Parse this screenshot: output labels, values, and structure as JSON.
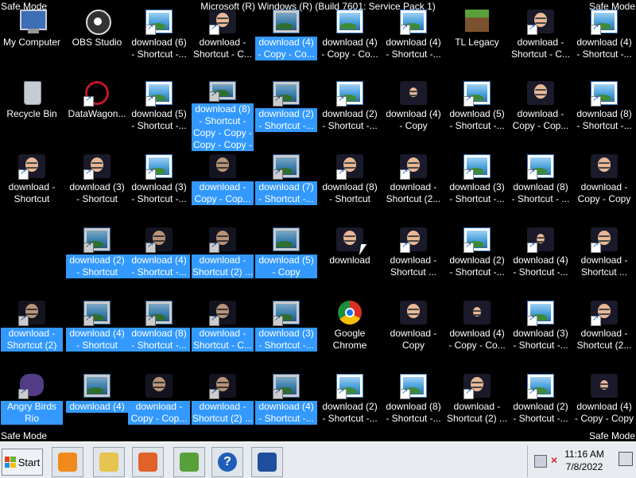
{
  "window": {
    "title": "Microsoft (R) Windows (R) (Build 7601: Service Pack 1)",
    "safe_mode": "Safe Mode"
  },
  "desktop": {
    "icons": [
      {
        "col": 0,
        "row": 0,
        "label": "My Computer",
        "img": "pc",
        "selected": false,
        "shortcut": false
      },
      {
        "col": 1,
        "row": 0,
        "label": "OBS Studio",
        "img": "obs",
        "selected": false,
        "shortcut": false
      },
      {
        "col": 2,
        "row": 0,
        "label": "download (6)\n- Shortcut -...",
        "img": "land",
        "selected": false,
        "shortcut": true
      },
      {
        "col": 3,
        "row": 0,
        "label": "download -\nShortcut - C...",
        "img": "face",
        "selected": false,
        "shortcut": true
      },
      {
        "col": 4,
        "row": 0,
        "label": "download (4)\n- Copy - Co...",
        "img": "land",
        "selected": true,
        "shortcut": false
      },
      {
        "col": 5,
        "row": 0,
        "label": "download (4)\n- Copy - Co...",
        "img": "land",
        "selected": false,
        "shortcut": false
      },
      {
        "col": 6,
        "row": 0,
        "label": "download (4)\n- Shortcut -...",
        "img": "land",
        "selected": false,
        "shortcut": true
      },
      {
        "col": 7,
        "row": 0,
        "label": "TL Legacy",
        "img": "grass",
        "selected": false,
        "shortcut": false
      },
      {
        "col": 8,
        "row": 0,
        "label": "download -\nShortcut - C...",
        "img": "face",
        "selected": false,
        "shortcut": true
      },
      {
        "col": 9,
        "row": 0,
        "label": "download (4)\n- Shortcut -...",
        "img": "land",
        "selected": false,
        "shortcut": true
      },
      {
        "col": 0,
        "row": 1,
        "label": "Recycle Bin",
        "img": "bin",
        "selected": false,
        "shortcut": false
      },
      {
        "col": 1,
        "row": 1,
        "label": "DataWagon...",
        "img": "web",
        "selected": false,
        "shortcut": true
      },
      {
        "col": 2,
        "row": 1,
        "label": "download (5)\n- Shortcut -...",
        "img": "land",
        "selected": false,
        "shortcut": true
      },
      {
        "col": 3,
        "row": 1,
        "label": "download (8)\n- Shortcut -\nCopy - Copy -\nCopy - Copy -\nCopy",
        "img": "land",
        "selected": true,
        "shortcut": true
      },
      {
        "col": 4,
        "row": 1,
        "label": "download (2)\n- Shortcut -...",
        "img": "land",
        "selected": true,
        "shortcut": true
      },
      {
        "col": 5,
        "row": 1,
        "label": "download (2)\n- Shortcut -...",
        "img": "land",
        "selected": false,
        "shortcut": true
      },
      {
        "col": 6,
        "row": 1,
        "label": "download (4)\n- Copy",
        "img": "facesmall",
        "selected": false,
        "shortcut": false
      },
      {
        "col": 7,
        "row": 1,
        "label": "download (5)\n- Shortcut -...",
        "img": "land",
        "selected": false,
        "shortcut": true
      },
      {
        "col": 8,
        "row": 1,
        "label": "download -\nCopy - Cop...",
        "img": "face",
        "selected": false,
        "shortcut": false
      },
      {
        "col": 9,
        "row": 1,
        "label": "download (8)\n- Shortcut -...",
        "img": "land",
        "selected": false,
        "shortcut": true
      },
      {
        "col": 0,
        "row": 2,
        "label": "download -\nShortcut",
        "img": "face",
        "selected": false,
        "shortcut": true
      },
      {
        "col": 1,
        "row": 2,
        "label": "download (3)\n- Shortcut",
        "img": "face",
        "selected": false,
        "shortcut": true
      },
      {
        "col": 2,
        "row": 2,
        "label": "download (3)\n- Shortcut -...",
        "img": "land",
        "selected": false,
        "shortcut": true
      },
      {
        "col": 3,
        "row": 2,
        "label": "download -\nCopy - Cop...",
        "img": "face",
        "selected": true,
        "shortcut": false
      },
      {
        "col": 4,
        "row": 2,
        "label": "download (7)\n- Shortcut -...",
        "img": "land",
        "selected": true,
        "shortcut": true
      },
      {
        "col": 5,
        "row": 2,
        "label": "download (8)\n- Shortcut",
        "img": "face",
        "selected": false,
        "shortcut": true
      },
      {
        "col": 6,
        "row": 2,
        "label": "download -\nShortcut (2...",
        "img": "face",
        "selected": false,
        "shortcut": true
      },
      {
        "col": 7,
        "row": 2,
        "label": "download (3)\n- Shortcut -...",
        "img": "land",
        "selected": false,
        "shortcut": true
      },
      {
        "col": 8,
        "row": 2,
        "label": "download (8)\n- Shortcut - ...",
        "img": "land",
        "selected": false,
        "shortcut": true
      },
      {
        "col": 9,
        "row": 2,
        "label": "download -\nCopy - Copy",
        "img": "face",
        "selected": false,
        "shortcut": false
      },
      {
        "col": 1,
        "row": 3,
        "label": "download (2)\n- Shortcut",
        "img": "land",
        "selected": true,
        "shortcut": true
      },
      {
        "col": 2,
        "row": 3,
        "label": "download (4)\n- Shortcut -...",
        "img": "face",
        "selected": true,
        "shortcut": true
      },
      {
        "col": 3,
        "row": 3,
        "label": "download -\nShortcut (2) ...",
        "img": "face",
        "selected": true,
        "shortcut": true
      },
      {
        "col": 4,
        "row": 3,
        "label": "download (5)\n- Copy",
        "img": "land",
        "selected": true,
        "shortcut": false
      },
      {
        "col": 5,
        "row": 3,
        "label": "download",
        "img": "face",
        "selected": false,
        "shortcut": false
      },
      {
        "col": 6,
        "row": 3,
        "label": "download -\nShortcut ...",
        "img": "face",
        "selected": false,
        "shortcut": true
      },
      {
        "col": 7,
        "row": 3,
        "label": "download (2)\n- Shortcut -...",
        "img": "land",
        "selected": false,
        "shortcut": true
      },
      {
        "col": 8,
        "row": 3,
        "label": "download (4)\n- Shortcut -...",
        "img": "facesmall",
        "selected": false,
        "shortcut": true
      },
      {
        "col": 9,
        "row": 3,
        "label": "download -\nShortcut ...",
        "img": "face",
        "selected": false,
        "shortcut": true
      },
      {
        "col": 0,
        "row": 4,
        "label": "download -\nShortcut (2)",
        "img": "face",
        "selected": true,
        "shortcut": true
      },
      {
        "col": 1,
        "row": 4,
        "label": "download (4)\n- Shortcut",
        "img": "land",
        "selected": true,
        "shortcut": true
      },
      {
        "col": 2,
        "row": 4,
        "label": "download (8)\n- Shortcut -...",
        "img": "land",
        "selected": true,
        "shortcut": true
      },
      {
        "col": 3,
        "row": 4,
        "label": "download -\nShortcut - C...",
        "img": "face",
        "selected": true,
        "shortcut": true
      },
      {
        "col": 4,
        "row": 4,
        "label": "download (3)\n- Shortcut -...",
        "img": "land",
        "selected": true,
        "shortcut": true
      },
      {
        "col": 5,
        "row": 4,
        "label": "Google\nChrome",
        "img": "chrome",
        "selected": false,
        "shortcut": false
      },
      {
        "col": 6,
        "row": 4,
        "label": "download -\nCopy",
        "img": "face",
        "selected": false,
        "shortcut": false
      },
      {
        "col": 7,
        "row": 4,
        "label": "download (4)\n- Copy - Co...",
        "img": "facesmall",
        "selected": false,
        "shortcut": false
      },
      {
        "col": 8,
        "row": 4,
        "label": "download (3)\n- Shortcut -...",
        "img": "land",
        "selected": false,
        "shortcut": true
      },
      {
        "col": 9,
        "row": 4,
        "label": "download -\nShortcut (2...",
        "img": "face",
        "selected": false,
        "shortcut": true
      },
      {
        "col": 0,
        "row": 5,
        "label": "Angry Birds\nRio",
        "img": "bird",
        "selected": true,
        "shortcut": true
      },
      {
        "col": 1,
        "row": 5,
        "label": "download (4)",
        "img": "land",
        "selected": true,
        "shortcut": false
      },
      {
        "col": 2,
        "row": 5,
        "label": "download -\nCopy - Cop...",
        "img": "face",
        "selected": true,
        "shortcut": false
      },
      {
        "col": 3,
        "row": 5,
        "label": "download -\nShortcut (2) ...",
        "img": "face",
        "selected": true,
        "shortcut": true
      },
      {
        "col": 4,
        "row": 5,
        "label": "download (4)\n- Shortcut -...",
        "img": "land",
        "selected": true,
        "shortcut": true
      },
      {
        "col": 5,
        "row": 5,
        "label": "download (2)\n- Shortcut -...",
        "img": "land",
        "selected": false,
        "shortcut": true
      },
      {
        "col": 6,
        "row": 5,
        "label": "download (8)\n- Shortcut -...",
        "img": "land",
        "selected": false,
        "shortcut": true
      },
      {
        "col": 7,
        "row": 5,
        "label": "download -\nShortcut (2) ...",
        "img": "face",
        "selected": false,
        "shortcut": true
      },
      {
        "col": 8,
        "row": 5,
        "label": "download (2)\n- Shortcut -...",
        "img": "land",
        "selected": false,
        "shortcut": true
      },
      {
        "col": 9,
        "row": 5,
        "label": "download (4)\n- Copy - Copy",
        "img": "facesmall",
        "selected": false,
        "shortcut": false
      }
    ]
  },
  "taskbar": {
    "start_label": "Start",
    "pinned": [
      {
        "name": "media-player-icon",
        "color": "#f08a1c"
      },
      {
        "name": "explorer-icon",
        "color": "#e7c350"
      },
      {
        "name": "firefox-icon",
        "color": "#e0612a"
      },
      {
        "name": "minecraft-icon",
        "color": "#58a03a"
      },
      {
        "name": "help-icon",
        "color": "#1f5db8"
      },
      {
        "name": "powershell-icon",
        "color": "#1e4f9e"
      }
    ],
    "clock_time": "11:16 AM",
    "clock_date": "7/8/2022"
  }
}
